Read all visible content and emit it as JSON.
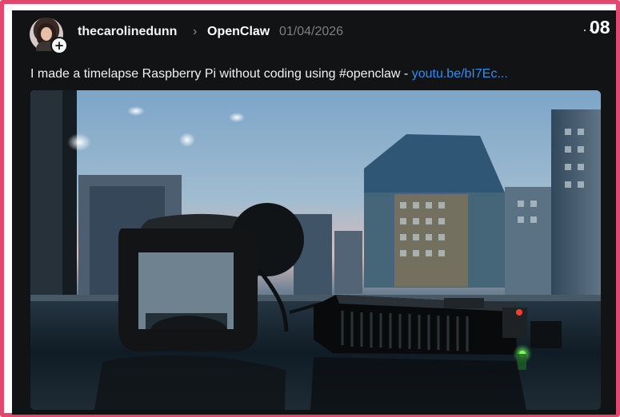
{
  "post": {
    "username": "thecarolinedunn",
    "separator": "›",
    "community": "OpenClaw",
    "date": "01/04/2026",
    "more_label": "···",
    "number_badge": "08",
    "text": "I made a timelapse Raspberry Pi without coding using #openclaw - ",
    "link_text": "youtu.be/bI7Ec..."
  },
  "avatar": {
    "plus_label": "+"
  },
  "colors": {
    "accent_border": "#e2476d",
    "card_background": "#121314",
    "link": "#2f8ff0"
  }
}
